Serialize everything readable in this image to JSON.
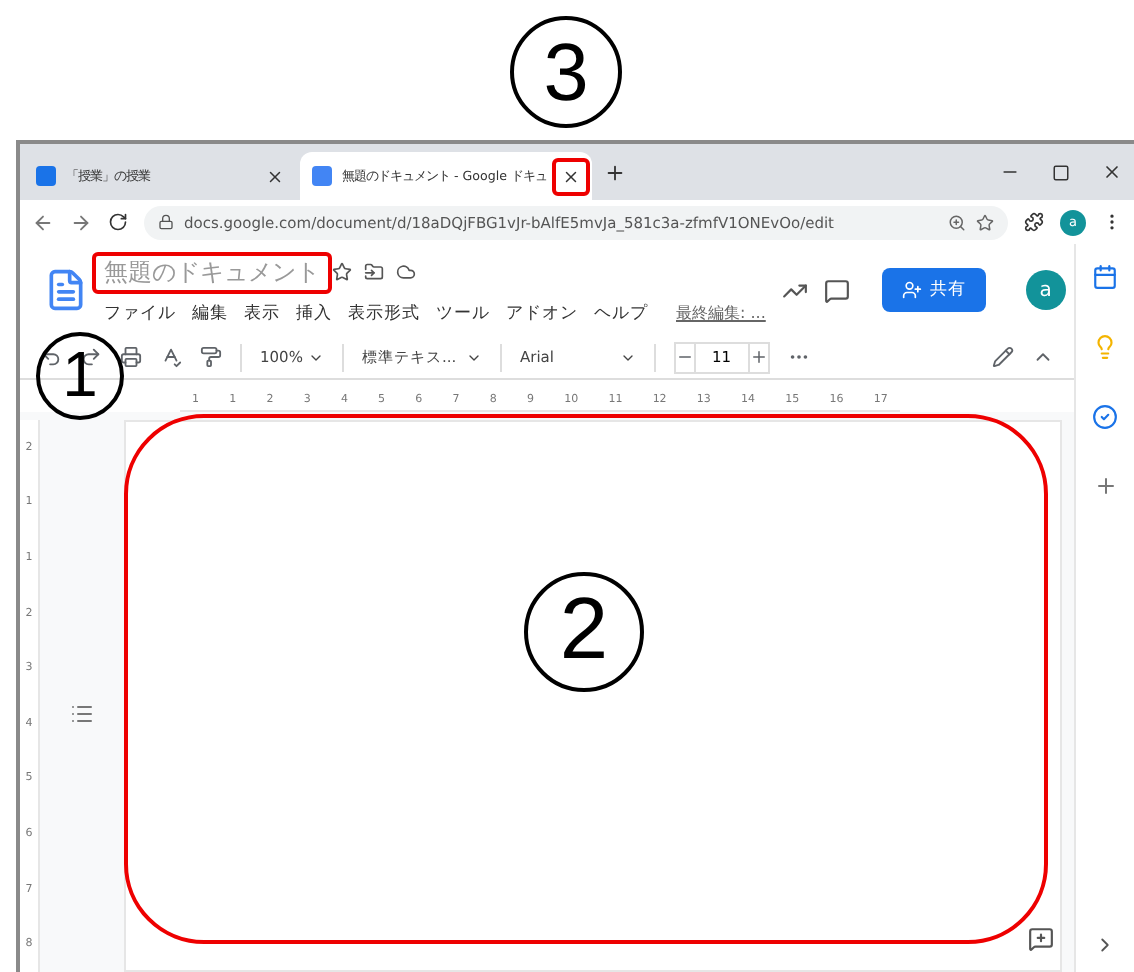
{
  "annotations": [
    {
      "label": "3",
      "kind": "callout"
    },
    {
      "label": "1",
      "kind": "callout"
    },
    {
      "label": "2",
      "kind": "callout"
    }
  ],
  "tabs": [
    {
      "title": "「授業」の授業",
      "selected": false
    },
    {
      "title": "無題のドキュメント - Google ドキュ",
      "selected": true
    }
  ],
  "address_bar": {
    "url": "docs.google.com/document/d/18aDQjFBG1vJr-bAlfE5mvJa_581c3a-zfmfV1ONEvOo/edit"
  },
  "profile": {
    "initial": "a"
  },
  "document": {
    "title": "無題のドキュメント",
    "share_label": "共有",
    "account_initial": "a",
    "last_edit": "最終編集: ..."
  },
  "menu": [
    "ファイル",
    "編集",
    "表示",
    "挿入",
    "表示形式",
    "ツール",
    "アドオン",
    "ヘルプ"
  ],
  "toolbar": {
    "zoom": "100%",
    "style": "標準テキス...",
    "font": "Arial",
    "size": "11"
  },
  "ruler": [
    "1",
    "1",
    "2",
    "3",
    "4",
    "5",
    "6",
    "7",
    "8",
    "9",
    "10",
    "11",
    "12",
    "13",
    "14",
    "15",
    "16",
    "17"
  ],
  "vertical_ruler": [
    "2",
    "1",
    "1",
    "2",
    "3",
    "4",
    "5",
    "6",
    "7",
    "8"
  ]
}
